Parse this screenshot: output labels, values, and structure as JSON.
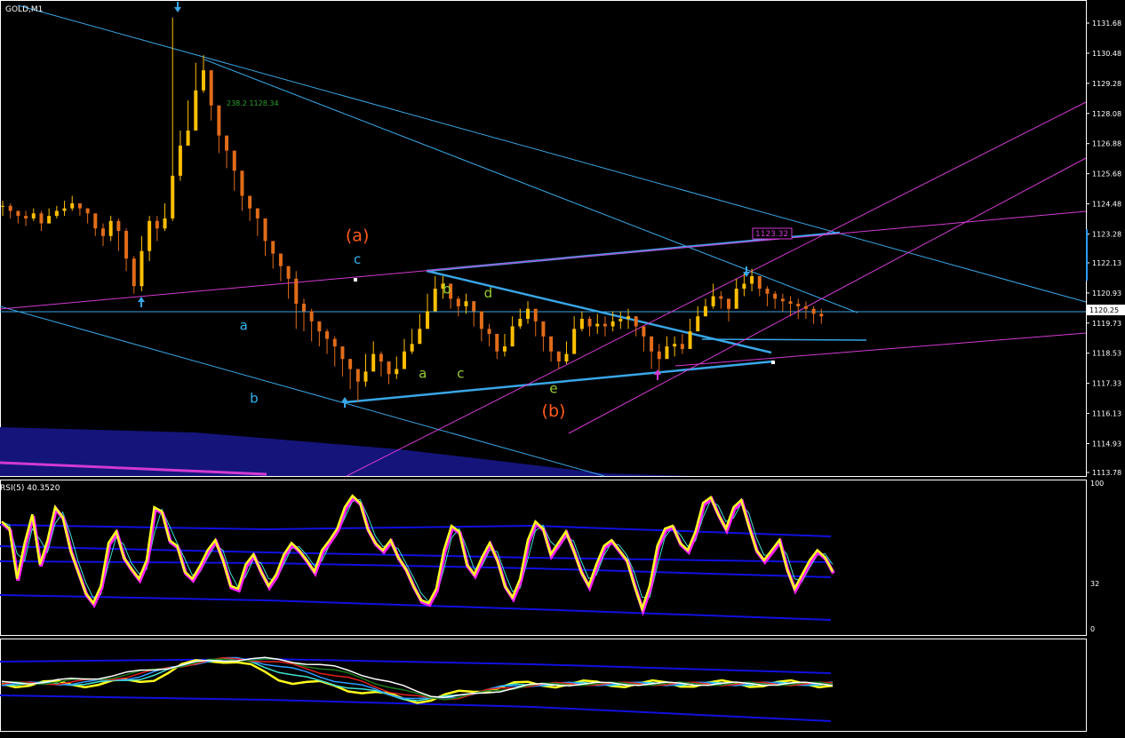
{
  "window": {
    "title": "GOLD,M1"
  },
  "colors": {
    "background": "#000000",
    "axis": "#ffffff",
    "candle_up": "#ffbf00",
    "candle_down": "#e06c1a",
    "trendline": "#39a6e6",
    "channel_magenta": "#d23ad2",
    "wave_label_cyan": "#35b3f0",
    "wave_label_green": "#9acd32",
    "wave_label_orange": "#ff5a1a",
    "rsi_main": "#ffff20",
    "rsi_shadow": "#ff20ff",
    "band_blue": "#1010e0",
    "lower_bar_fill": "#14147a"
  },
  "chart_data": [
    {
      "type": "candlestick",
      "title": "GOLD,M1",
      "y_ticks": [
        1131.68,
        1130.48,
        1129.28,
        1128.08,
        1126.88,
        1125.68,
        1124.48,
        1123.28,
        1122.13,
        1120.93,
        1119.73,
        1118.53,
        1117.33,
        1116.13,
        1114.93,
        1113.78
      ],
      "current_price": "1120.25",
      "price_label": "1123.32",
      "fib_label": "238.2 1128.34",
      "wave_labels": [
        {
          "text": "(a)",
          "x": 10.3,
          "y": 1123.0,
          "color": "orange"
        },
        {
          "text": "c",
          "x": 10.3,
          "y": 1122.1,
          "color": "cyan"
        },
        {
          "text": "a",
          "x": 7.0,
          "y": 1119.45,
          "color": "cyan"
        },
        {
          "text": "b",
          "x": 7.3,
          "y": 1116.55,
          "color": "cyan"
        },
        {
          "text": "b",
          "x": 12.9,
          "y": 1120.9,
          "color": "green"
        },
        {
          "text": "d",
          "x": 14.1,
          "y": 1120.75,
          "color": "green"
        },
        {
          "text": "a",
          "x": 12.2,
          "y": 1117.55,
          "color": "green"
        },
        {
          "text": "c",
          "x": 13.3,
          "y": 1117.55,
          "color": "green"
        },
        {
          "text": "e",
          "x": 16.0,
          "y": 1116.95,
          "color": "green"
        },
        {
          "text": "(b)",
          "x": 16.0,
          "y": 1116.0,
          "color": "orange"
        }
      ],
      "close_series": [
        1124.4,
        1124.2,
        1124.0,
        1123.9,
        1124.1,
        1123.7,
        1124.0,
        1124.2,
        1124.3,
        1124.5,
        1124.3,
        1124.1,
        1123.5,
        1123.2,
        1123.8,
        1123.4,
        1122.3,
        1121.2,
        1122.6,
        1123.8,
        1123.5,
        1123.9,
        1125.6,
        1126.8,
        1127.4,
        1129.0,
        1129.8,
        1128.4,
        1127.2,
        1126.6,
        1125.8,
        1124.8,
        1124.3,
        1123.9,
        1123.0,
        1122.5,
        1122.0,
        1121.5,
        1120.5,
        1120.2,
        1119.8,
        1119.4,
        1119.1,
        1118.8,
        1118.3,
        1117.9,
        1117.4,
        1117.8,
        1118.5,
        1118.2,
        1117.7,
        1117.9,
        1118.6,
        1118.9,
        1119.5,
        1120.2,
        1121.1,
        1121.3,
        1120.7,
        1120.4,
        1120.6,
        1120.2,
        1119.5,
        1119.3,
        1118.6,
        1118.8,
        1119.6,
        1119.9,
        1120.3,
        1119.8,
        1119.2,
        1118.6,
        1118.2,
        1118.5,
        1119.5,
        1119.9,
        1119.6,
        1119.7,
        1119.6,
        1119.8,
        1119.9,
        1120.0,
        1119.6,
        1119.2,
        1118.6,
        1118.3,
        1118.8,
        1118.9,
        1118.7,
        1119.4,
        1120.0,
        1120.4,
        1120.8,
        1120.7,
        1120.3,
        1121.1,
        1121.3,
        1121.6,
        1121.1,
        1120.9,
        1120.7,
        1120.6,
        1120.5,
        1120.4,
        1120.3,
        1120.1,
        1120.0
      ],
      "high_series": [
        1124.6,
        1124.5,
        1124.2,
        1124.2,
        1124.3,
        1124.2,
        1124.3,
        1124.4,
        1124.6,
        1124.8,
        1124.5,
        1124.3,
        1124.0,
        1123.7,
        1124.0,
        1123.9,
        1123.5,
        1122.4,
        1123.2,
        1124.0,
        1124.0,
        1124.5,
        1131.9,
        1127.4,
        1128.6,
        1130.1,
        1130.4,
        1129.6,
        1128.0,
        1127.2,
        1126.3,
        1125.3,
        1124.8,
        1124.3,
        1123.6,
        1122.9,
        1122.5,
        1122.0,
        1121.8,
        1120.7,
        1120.3,
        1119.8,
        1119.5,
        1119.2,
        1118.7,
        1118.3,
        1117.9,
        1118.5,
        1119.0,
        1118.6,
        1118.1,
        1118.4,
        1119.1,
        1119.5,
        1120.1,
        1120.9,
        1121.6,
        1121.6,
        1121.1,
        1120.8,
        1120.9,
        1120.6,
        1120.0,
        1119.7,
        1119.0,
        1119.3,
        1120.0,
        1120.3,
        1120.6,
        1120.2,
        1119.6,
        1119.0,
        1118.6,
        1119.0,
        1120.0,
        1120.2,
        1120.0,
        1120.1,
        1120.0,
        1120.2,
        1120.2,
        1120.3,
        1120.0,
        1119.6,
        1119.0,
        1118.9,
        1119.2,
        1119.2,
        1119.3,
        1119.9,
        1120.4,
        1120.7,
        1121.3,
        1121.0,
        1120.7,
        1121.5,
        1121.7,
        1121.9,
        1121.5,
        1121.2,
        1121.0,
        1120.9,
        1120.8,
        1120.7,
        1120.6,
        1120.4,
        1120.3
      ],
      "low_series": [
        1124.0,
        1123.9,
        1123.7,
        1123.6,
        1123.8,
        1123.4,
        1123.7,
        1123.9,
        1124.0,
        1124.2,
        1124.0,
        1123.7,
        1123.2,
        1122.8,
        1123.0,
        1122.6,
        1121.8,
        1120.9,
        1121.0,
        1122.2,
        1123.0,
        1123.4,
        1123.8,
        1125.4,
        1126.8,
        1128.2,
        1128.9,
        1127.8,
        1126.5,
        1125.9,
        1125.0,
        1124.2,
        1123.8,
        1123.2,
        1122.4,
        1121.9,
        1121.4,
        1120.7,
        1119.5,
        1119.4,
        1119.0,
        1118.8,
        1118.5,
        1118.0,
        1117.6,
        1117.1,
        1116.6,
        1117.2,
        1118.0,
        1117.6,
        1117.3,
        1117.5,
        1118.2,
        1118.5,
        1119.0,
        1119.8,
        1120.4,
        1120.7,
        1120.3,
        1120.0,
        1120.1,
        1119.6,
        1119.0,
        1118.8,
        1118.3,
        1118.4,
        1119.2,
        1119.5,
        1119.7,
        1119.2,
        1118.6,
        1118.2,
        1117.9,
        1118.1,
        1119.1,
        1119.4,
        1119.2,
        1119.3,
        1119.2,
        1119.4,
        1119.5,
        1119.5,
        1119.2,
        1118.6,
        1117.9,
        1117.8,
        1118.4,
        1118.4,
        1118.5,
        1119.0,
        1119.6,
        1120.0,
        1120.3,
        1120.3,
        1119.8,
        1120.5,
        1120.8,
        1121.0,
        1120.8,
        1120.4,
        1120.3,
        1120.2,
        1120.0,
        1119.9,
        1119.9,
        1119.7,
        1119.7
      ]
    },
    {
      "type": "line",
      "title": "RSI(5) 40.3520",
      "ylim": [
        0,
        100
      ],
      "y_ticks": [
        "100",
        "32",
        "0"
      ],
      "series": [
        {
          "values": [
            75,
            70,
            35,
            60,
            80,
            45,
            62,
            85,
            78,
            55,
            40,
            25,
            18,
            30,
            60,
            68,
            50,
            42,
            35,
            48,
            85,
            82,
            62,
            58,
            40,
            35,
            44,
            55,
            62,
            48,
            30,
            28,
            45,
            52,
            40,
            30,
            38,
            52,
            60,
            55,
            48,
            40,
            55,
            62,
            70,
            85,
            93,
            88,
            70,
            60,
            55,
            62,
            50,
            42,
            30,
            20,
            18,
            28,
            55,
            72,
            68,
            45,
            38,
            50,
            60,
            48,
            30,
            22,
            35,
            62,
            75,
            70,
            52,
            60,
            68,
            55,
            40,
            30,
            45,
            58,
            62,
            55,
            48,
            30,
            14,
            30,
            58,
            70,
            72,
            60,
            55,
            68,
            88,
            92,
            80,
            70,
            85,
            90,
            72,
            55,
            48,
            55,
            62,
            42,
            28,
            38,
            48,
            55,
            50,
            40
          ]
        }
      ]
    }
  ]
}
